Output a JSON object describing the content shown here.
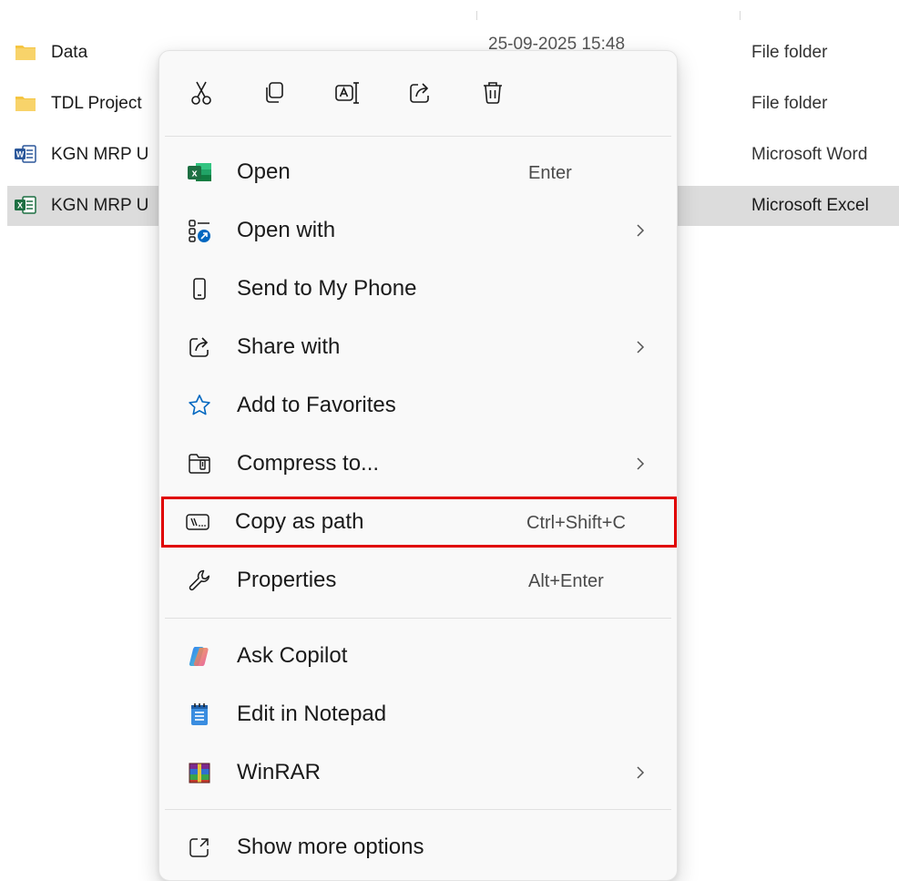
{
  "explorer": {
    "rows": [
      {
        "name": "Data",
        "date": "25-09-2025 15:48",
        "type": "File folder",
        "icon": "folder-icon"
      },
      {
        "name": "TDL Project",
        "date": "",
        "type": "File folder",
        "icon": "folder-icon"
      },
      {
        "name": "KGN MRP U",
        "date": "",
        "type": "Microsoft Word",
        "icon": "word-doc-icon"
      },
      {
        "name": "KGN MRP U",
        "date": "",
        "type": "Microsoft Excel",
        "icon": "excel-doc-icon"
      }
    ]
  },
  "context_menu": {
    "quick_actions": [
      {
        "name": "cut",
        "icon": "scissors-icon"
      },
      {
        "name": "copy",
        "icon": "copy-icon"
      },
      {
        "name": "rename",
        "icon": "rename-icon"
      },
      {
        "name": "share",
        "icon": "share-icon"
      },
      {
        "name": "delete",
        "icon": "trash-icon"
      }
    ],
    "items": [
      {
        "label": "Open",
        "shortcut": "Enter",
        "icon": "excel-app-icon",
        "submenu": false
      },
      {
        "label": "Open with",
        "shortcut": "",
        "icon": "open-with-icon",
        "submenu": true
      },
      {
        "label": "Send to My Phone",
        "shortcut": "",
        "icon": "phone-icon",
        "submenu": false
      },
      {
        "label": "Share with",
        "shortcut": "",
        "icon": "share-icon",
        "submenu": true
      },
      {
        "label": "Add to Favorites",
        "shortcut": "",
        "icon": "star-icon",
        "submenu": false
      },
      {
        "label": "Compress to...",
        "shortcut": "",
        "icon": "zip-folder-icon",
        "submenu": true
      },
      {
        "label": "Copy as path",
        "shortcut": "Ctrl+Shift+C",
        "icon": "copy-path-icon",
        "submenu": false,
        "highlighted": true
      },
      {
        "label": "Properties",
        "shortcut": "Alt+Enter",
        "icon": "wrench-icon",
        "submenu": false
      },
      {
        "label": "Ask Copilot",
        "shortcut": "",
        "icon": "copilot-icon",
        "submenu": false
      },
      {
        "label": "Edit in Notepad",
        "shortcut": "",
        "icon": "notepad-icon",
        "submenu": false
      },
      {
        "label": "WinRAR",
        "shortcut": "",
        "icon": "winrar-icon",
        "submenu": true
      },
      {
        "label": "Show more options",
        "shortcut": "",
        "icon": "more-options-icon",
        "submenu": false
      }
    ]
  },
  "colors": {
    "highlight_border": "#e00000",
    "selected_row": "#dcdcdc",
    "menu_bg": "#f9f9f9",
    "excel_green": "#1d6f42",
    "word_blue": "#2b579a",
    "folder_yellow": "#f5c542",
    "accent_blue": "#0067c0"
  }
}
